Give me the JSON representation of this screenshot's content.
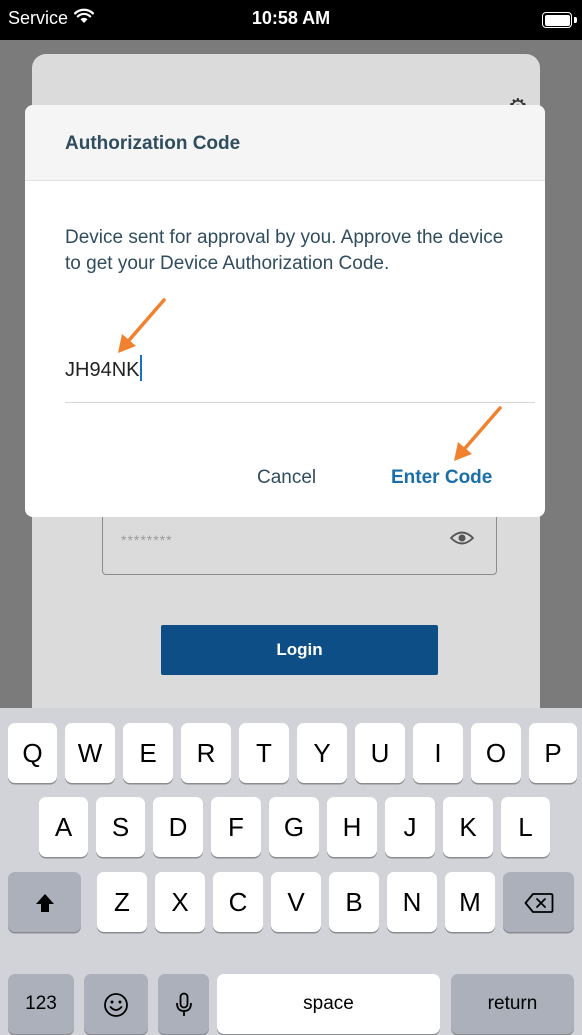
{
  "status_bar": {
    "carrier": "Service",
    "wifi_icon": "wifi-icon",
    "time": "10:58 AM",
    "battery_icon": "battery-icon"
  },
  "background_screen": {
    "password_mask": "********",
    "eye_icon": "eye-icon",
    "login_label": "Login",
    "login_color": "#0e4e86"
  },
  "dialog": {
    "title": "Authorization Code",
    "message": "Device sent for approval by you. Approve the device to get your Device Authorization Code.",
    "code_value": "JH94NK",
    "cancel_label": "Cancel",
    "enter_code_label": "Enter Code",
    "accent_color": "#1a6fa8",
    "annotation_arrow_color": "#f0822f"
  },
  "keyboard": {
    "row1": [
      "Q",
      "W",
      "E",
      "R",
      "T",
      "Y",
      "U",
      "I",
      "O",
      "P"
    ],
    "row2": [
      "A",
      "S",
      "D",
      "F",
      "G",
      "H",
      "J",
      "K",
      "L"
    ],
    "row3": [
      "Z",
      "X",
      "C",
      "V",
      "B",
      "N",
      "M"
    ],
    "shift_icon": "shift-icon",
    "delete_icon": "delete-icon",
    "numbers_label": "123",
    "emoji_icon": "emoji-icon",
    "mic_icon": "microphone-icon",
    "space_label": "space",
    "return_label": "return"
  }
}
